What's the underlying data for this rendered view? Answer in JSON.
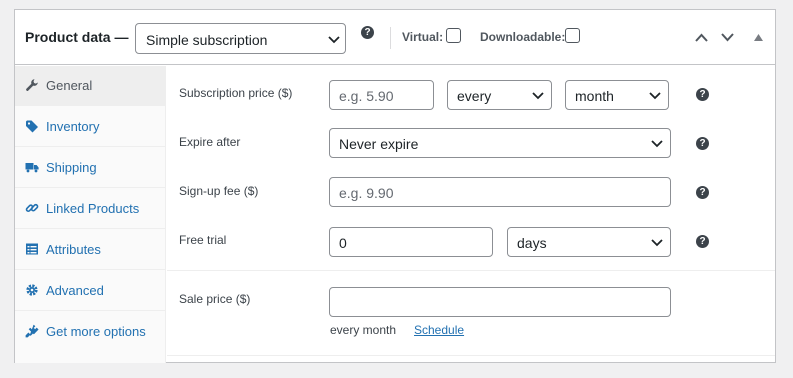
{
  "header": {
    "title": "Product data —",
    "product_type": "Simple subscription",
    "virtual_label": "Virtual:",
    "downloadable_label": "Downloadable:",
    "virtual_checked": false,
    "downloadable_checked": false
  },
  "sidebar": {
    "items": [
      {
        "label": "General",
        "icon": "wrench-icon",
        "active": true
      },
      {
        "label": "Inventory",
        "icon": "tag-icon",
        "active": false
      },
      {
        "label": "Shipping",
        "icon": "truck-icon",
        "active": false
      },
      {
        "label": "Linked Products",
        "icon": "link-icon",
        "active": false
      },
      {
        "label": "Attributes",
        "icon": "list-icon",
        "active": false
      },
      {
        "label": "Advanced",
        "icon": "gear-icon",
        "active": false
      },
      {
        "label": "Get more options",
        "icon": "plugin-icon",
        "active": false
      }
    ]
  },
  "general": {
    "subscription_price": {
      "label": "Subscription price ($)",
      "placeholder": "e.g. 5.90",
      "interval": "every",
      "period": "month"
    },
    "expire_after": {
      "label": "Expire after",
      "value": "Never expire"
    },
    "signup_fee": {
      "label": "Sign-up fee ($)",
      "placeholder": "e.g. 9.90"
    },
    "free_trial": {
      "label": "Free trial",
      "value": "0",
      "period": "days"
    },
    "sale_price": {
      "label": "Sale price ($)",
      "value": "",
      "description": "every month",
      "schedule_link": "Schedule"
    }
  },
  "colors": {
    "link": "#2271b1",
    "border": "#8c8f94",
    "panel_border": "#c3c4c7",
    "help_icon": "#3c434a"
  }
}
